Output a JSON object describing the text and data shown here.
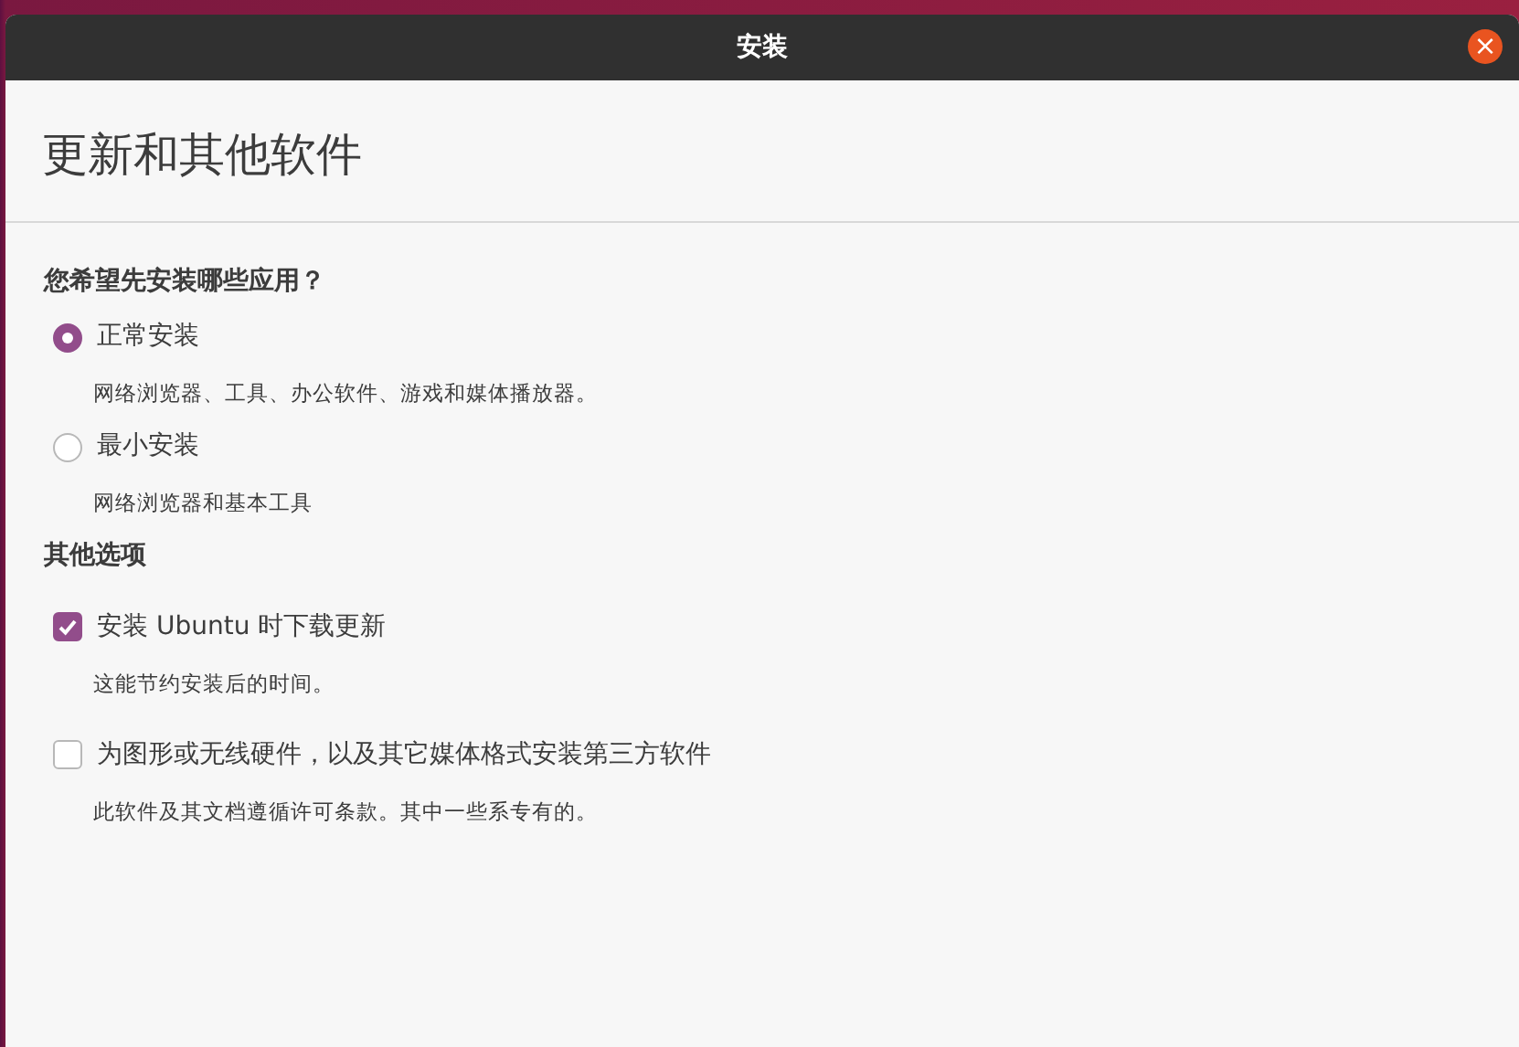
{
  "window": {
    "title": "安装",
    "close": "×"
  },
  "page_title": "更新和其他软件",
  "install_question": "您希望先安装哪些应用？",
  "install_options": [
    {
      "label": "正常安装",
      "description": "网络浏览器、工具、办公软件、游戏和媒体播放器。",
      "selected": true
    },
    {
      "label": "最小安装",
      "description": "网络浏览器和基本工具",
      "selected": false
    }
  ],
  "other_heading": "其他选项",
  "other_options": [
    {
      "label": "安装 Ubuntu 时下载更新",
      "description": "这能节约安装后的时间。",
      "checked": true
    },
    {
      "label": "为图形或无线硬件，以及其它媒体格式安装第三方软件",
      "description": "此软件及其文档遵循许可条款。其中一些系专有的。",
      "checked": false
    }
  ]
}
